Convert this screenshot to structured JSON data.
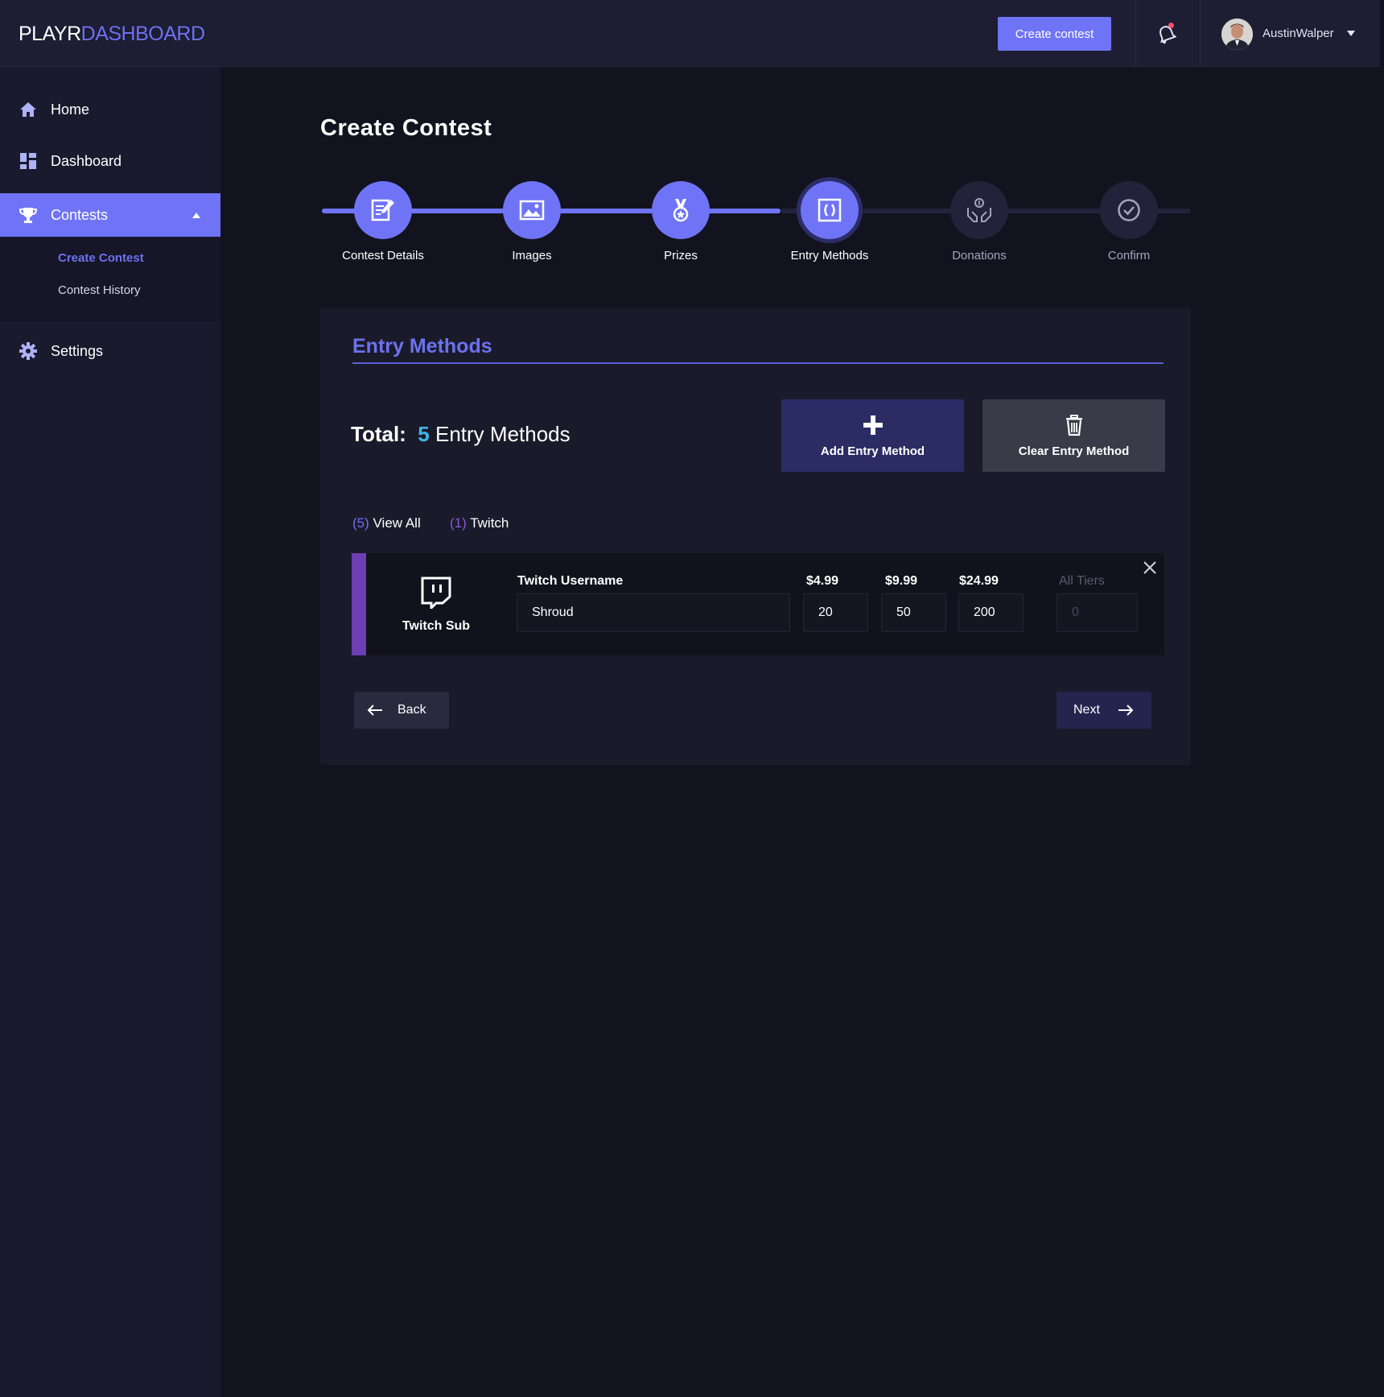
{
  "header": {
    "logo_primary": "PLAYR",
    "logo_secondary": "DASHBOARD",
    "create_button": "Create contest",
    "username": "AustinWalper"
  },
  "sidebar": {
    "items": [
      {
        "label": "Home",
        "icon": "home-icon"
      },
      {
        "label": "Dashboard",
        "icon": "dashboard-icon"
      },
      {
        "label": "Contests",
        "icon": "trophy-icon",
        "active": true
      },
      {
        "label": "Settings",
        "icon": "gear-icon"
      }
    ],
    "subitems": [
      {
        "label": "Create Contest",
        "active": true
      },
      {
        "label": "Contest History"
      }
    ]
  },
  "page": {
    "title": "Create Contest"
  },
  "stepper": {
    "steps": [
      {
        "label": "Contest Details",
        "icon": "edit-document-icon",
        "state": "done"
      },
      {
        "label": "Images",
        "icon": "image-icon",
        "state": "done"
      },
      {
        "label": "Prizes",
        "icon": "medal-icon",
        "state": "done"
      },
      {
        "label": "Entry Methods",
        "icon": "entry-methods-icon",
        "state": "current"
      },
      {
        "label": "Donations",
        "icon": "donation-hands-icon",
        "state": "todo"
      },
      {
        "label": "Confirm",
        "icon": "check-circle-icon",
        "state": "todo"
      }
    ]
  },
  "entry_methods": {
    "section_title": "Entry Methods",
    "total_label": "Total:",
    "total_count": "5",
    "total_suffix": "Entry Methods",
    "add_button": "Add Entry Method",
    "clear_button": "Clear Entry Method",
    "filters": [
      {
        "count": "(5)",
        "label": "View All"
      },
      {
        "count": "(1)",
        "label": "Twitch"
      }
    ],
    "entry": {
      "type_label": "Twitch Sub",
      "username_label": "Twitch Username",
      "username_value": "Shroud",
      "tier1_label": "$4.99",
      "tier1_value": "20",
      "tier2_label": "$9.99",
      "tier2_value": "50",
      "tier3_label": "$24.99",
      "tier3_value": "200",
      "all_tiers_label": "All Tiers",
      "all_tiers_placeholder": "0"
    },
    "back_button": "Back",
    "next_button": "Next"
  },
  "colors": {
    "accent": "#6f74f6",
    "background": "#13131f",
    "panel": "#1a1a2b",
    "twitch_bar": "#6c3fb2",
    "total_count": "#3fb6e8"
  }
}
